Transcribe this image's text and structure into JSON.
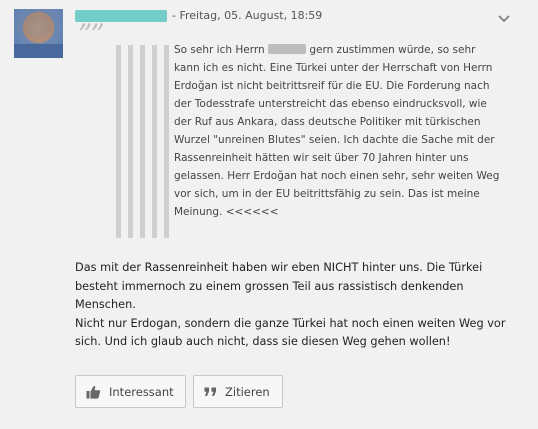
{
  "post": {
    "meta": "- Freitag, 05. August, 18:59",
    "quote_marks": "””",
    "chevron": "∨"
  },
  "quote": {
    "line1a": "So sehr ich Herrn",
    "line1b": "gern zustimmen würde, so sehr kann ich es nicht. Eine Türkei unter der Herrschaft von Herrn Erdoğan ist nicht beitrittsreif für die EU. Die Forderung nach der Todesstrafe unterstreicht das ebenso eindrucksvoll, wie der Ruf aus Ankara, dass deutsche Politiker mit türkischen Wurzel \"unreinen Blutes\" seien. Ich dachte die Sache mit der Rassenreinheit hätten wir seit über 70 Jahren hinter uns gelassen. Herr Erdoğan hat noch einen sehr, sehr weiten Weg vor sich, um in der EU beitrittsfähig zu sein. Das ist meine Meinung. <<<<<<"
  },
  "reply": {
    "para1": "Das mit der Rassenreinheit haben wir eben NICHT hinter uns. Die Türkei besteht immernoch zu einem grossen Teil aus rassistisch denkenden Menschen.",
    "para2": "Nicht nur Erdogan, sondern die ganze Türkei hat noch einen weiten Weg vor sich. Und ich glaub auch nicht, dass sie diesen Weg gehen wollen!"
  },
  "actions": {
    "like_label": "Interessant",
    "quote_label": "Zitieren",
    "like_icon": "thumbs-up-icon",
    "quote_icon": "quote-icon"
  }
}
